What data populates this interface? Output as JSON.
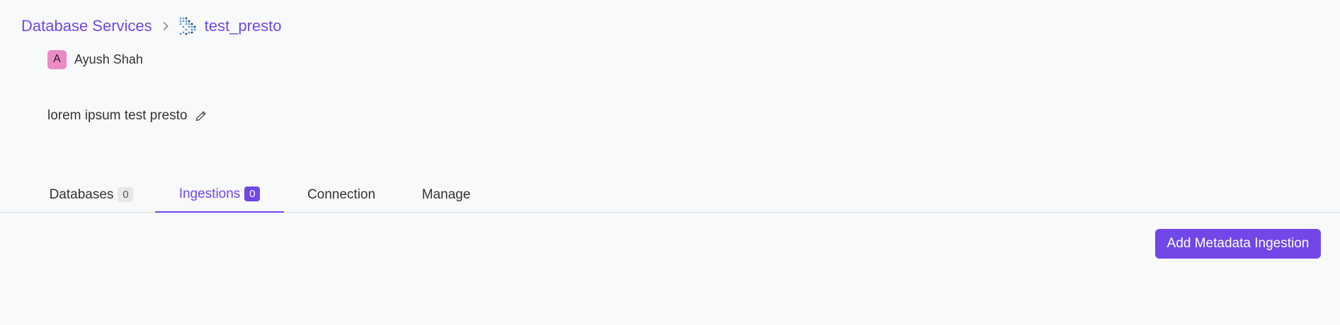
{
  "breadcrumb": {
    "parent": "Database Services",
    "separator_icon": "chevron-right-icon",
    "service_logo_icon": "presto-logo-icon",
    "current": "test_presto"
  },
  "owner": {
    "avatar_initial": "A",
    "avatar_color": "#e98bc5",
    "name": "Ayush Shah"
  },
  "description": {
    "text": "lorem ipsum test presto",
    "edit_icon": "pencil-icon"
  },
  "tabs": [
    {
      "label": "Databases",
      "count": "0",
      "active": false
    },
    {
      "label": "Ingestions",
      "count": "0",
      "active": true
    },
    {
      "label": "Connection",
      "active": false
    },
    {
      "label": "Manage",
      "active": false
    }
  ],
  "actions": {
    "add_metadata_ingestion": "Add Metadata Ingestion"
  },
  "colors": {
    "accent": "#7147e8",
    "background": "#f8f9fa"
  }
}
